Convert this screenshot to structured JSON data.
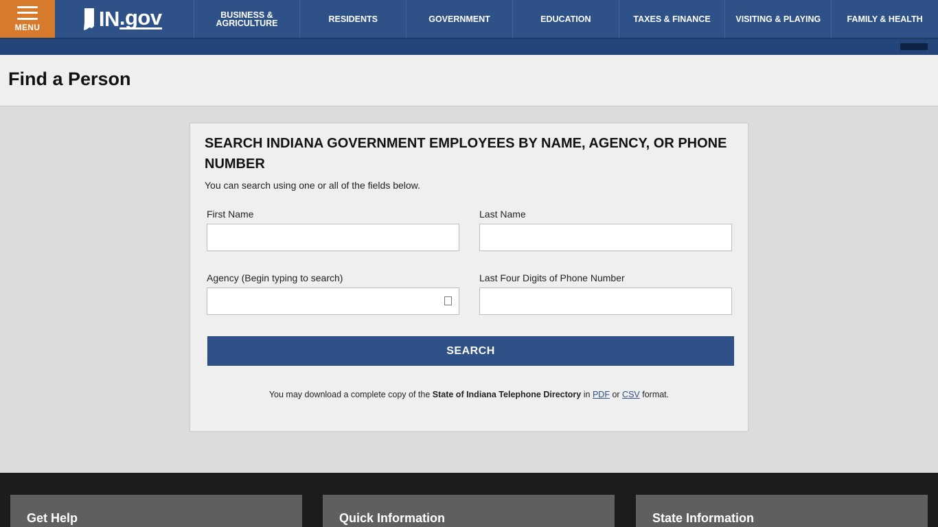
{
  "header": {
    "menu_label": "MENU",
    "logo_text": "IN",
    "logo_suffix": ".gov",
    "nav": [
      {
        "label": "BUSINESS & AGRICULTURE"
      },
      {
        "label": "RESIDENTS"
      },
      {
        "label": "GOVERNMENT"
      },
      {
        "label": "EDUCATION"
      },
      {
        "label": "TAXES & FINANCE"
      },
      {
        "label": "VISITING & PLAYING"
      },
      {
        "label": "FAMILY & HEALTH"
      }
    ]
  },
  "page": {
    "title": "Find a Person"
  },
  "search": {
    "heading": "SEARCH INDIANA GOVERNMENT EMPLOYEES BY NAME, AGENCY, OR PHONE NUMBER",
    "subtext": "You can search using one or all of the fields below.",
    "first_name_label": "First Name",
    "first_name_value": "",
    "last_name_label": "Last Name",
    "last_name_value": "",
    "agency_label": "Agency (Begin typing to search)",
    "agency_value": "",
    "phone_label": "Last Four Digits of Phone Number",
    "phone_value": "",
    "button_label": "SEARCH",
    "download_prefix": "You may download a complete copy of the",
    "download_bold": "State of Indiana Telephone Directory",
    "download_in": "in",
    "download_pdf": "PDF",
    "download_or": "or",
    "download_csv": "CSV",
    "download_suffix": "format."
  },
  "footer": {
    "cards": [
      {
        "label": "Get Help"
      },
      {
        "label": "Quick Information"
      },
      {
        "label": "State Information"
      }
    ]
  },
  "colors": {
    "nav_blue": "#2e5188",
    "menu_orange": "#d87a2b",
    "footer_dark": "#1c1c1c"
  }
}
